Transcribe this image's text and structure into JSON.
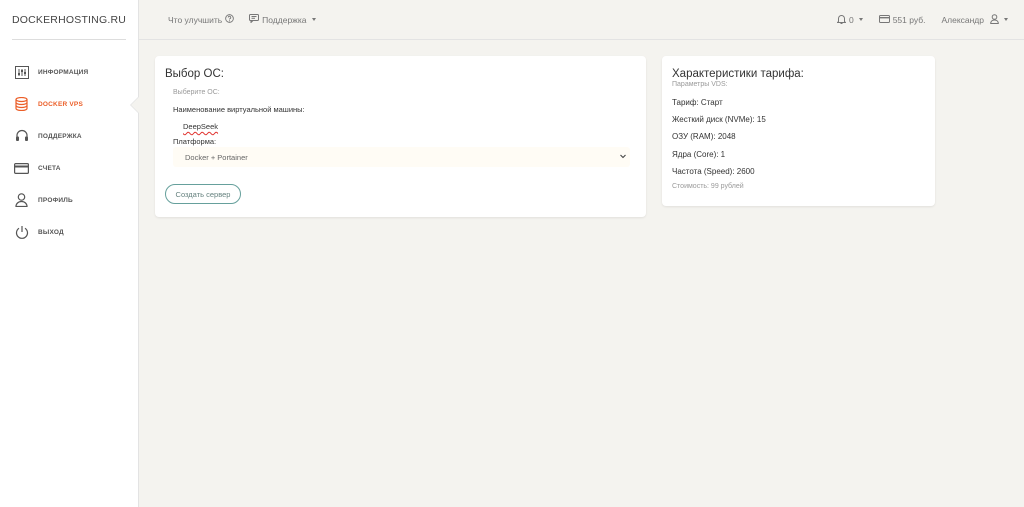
{
  "sidebar": {
    "logo": "DOCKERHOSTING.RU",
    "items": [
      {
        "label": "ИНФОРМАЦИЯ",
        "icon": "sliders-icon",
        "active": false
      },
      {
        "label": "DOCKER VPS",
        "icon": "database-icon",
        "active": true
      },
      {
        "label": "ПОДДЕРЖКА",
        "icon": "headset-icon",
        "active": false
      },
      {
        "label": "СЧЕТА",
        "icon": "credit-card-icon",
        "active": false
      },
      {
        "label": "ПРОФИЛЬ",
        "icon": "user-icon",
        "active": false
      },
      {
        "label": "ВЫХОД",
        "icon": "power-icon",
        "active": false
      }
    ]
  },
  "topbar": {
    "improve": "Что улучшить",
    "support": "Поддержка",
    "notifications_count": "0",
    "balance": "551 руб.",
    "user": "Александр"
  },
  "os_card": {
    "title": "Выбор ОС:",
    "subtitle": "Выберите ОС:",
    "vm_name_label": "Наименование виртуальной машины:",
    "vm_name_value": "DeepSeek",
    "platform_label": "Платформа:",
    "platform_value": "Docker + Portainer",
    "create_button": "Создать сервер"
  },
  "tariff_card": {
    "title": "Характеристики тарифа:",
    "subtitle": "Параметры VDS:",
    "specs": [
      "Тариф: Старт",
      "Жесткий диск (NVMe): 15",
      "ОЗУ (RAM): 2048",
      "Ядра (Core): 1",
      "Частота (Speed): 2600"
    ],
    "cost": "Стоимость: 99 рублей"
  },
  "colors": {
    "accent": "#eb5e28",
    "button_border": "#66a09c",
    "background": "#f4f3ef"
  }
}
